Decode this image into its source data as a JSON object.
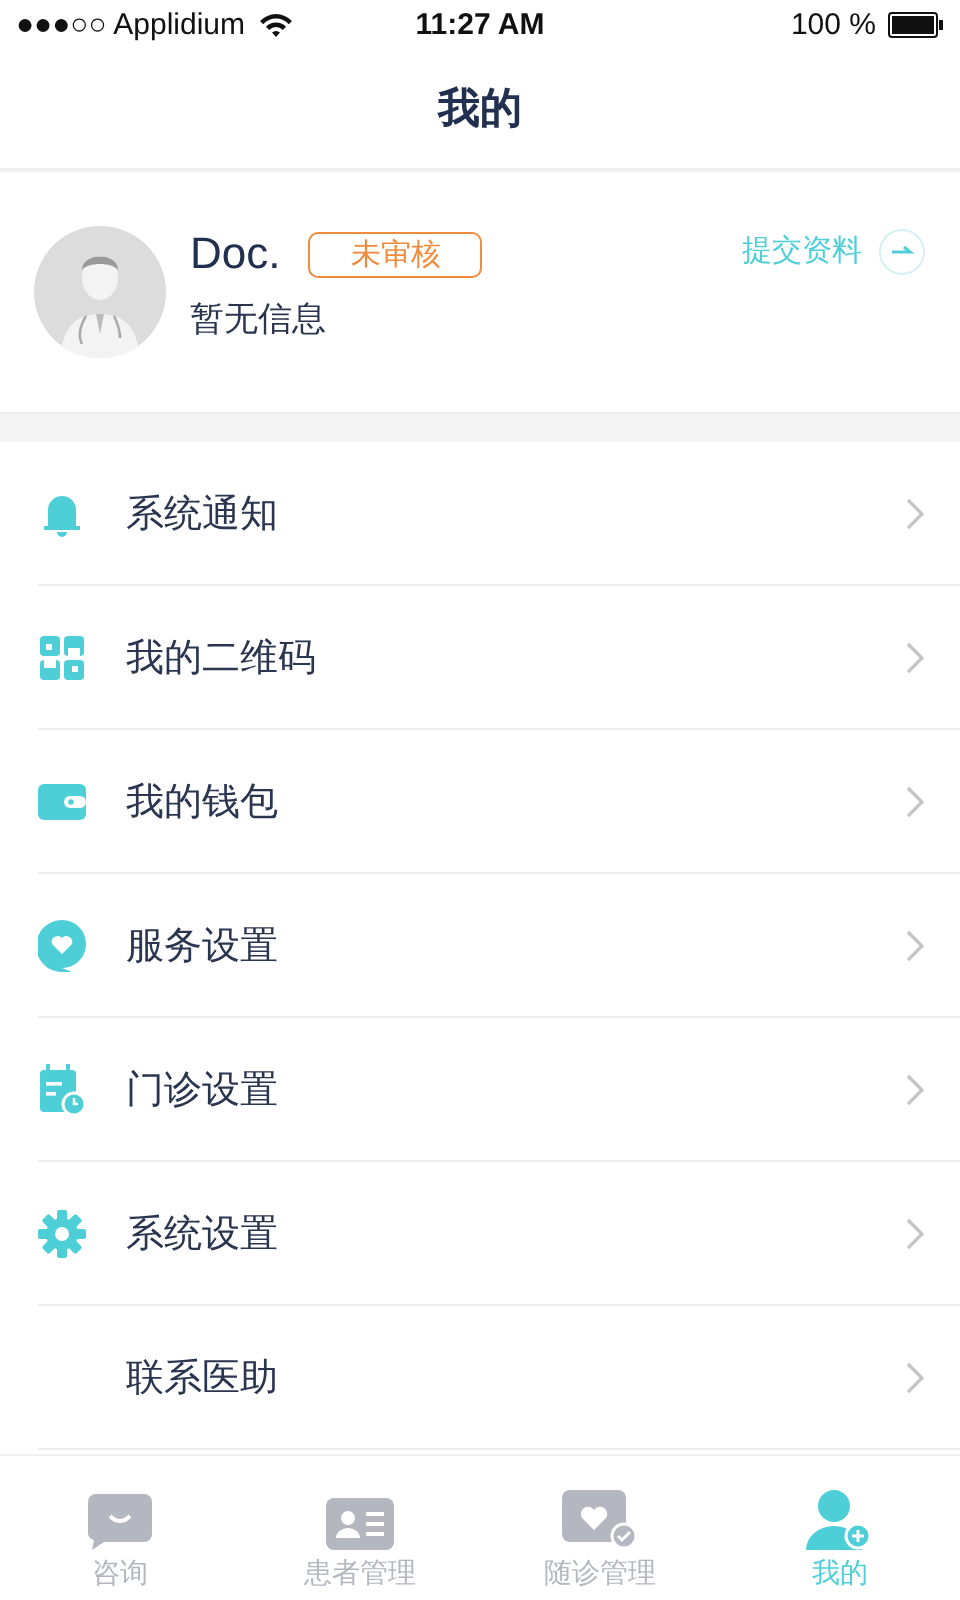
{
  "status_bar": {
    "carrier": "●●●○○ Applidium",
    "time": "11:27 AM",
    "battery": "100 %"
  },
  "nav": {
    "title": "我的"
  },
  "profile": {
    "name": "Doc.",
    "badge": "未审核",
    "subtitle": "暂无信息",
    "action": "提交资料"
  },
  "menu": [
    {
      "label": "系统通知"
    },
    {
      "label": "我的二维码"
    },
    {
      "label": "我的钱包"
    },
    {
      "label": "服务设置"
    },
    {
      "label": "门诊设置"
    },
    {
      "label": "系统设置"
    },
    {
      "label": "联系医助"
    }
  ],
  "tabs": [
    {
      "label": "咨询",
      "selected": false
    },
    {
      "label": "患者管理",
      "selected": false
    },
    {
      "label": "随诊管理",
      "selected": false
    },
    {
      "label": "我的",
      "selected": true
    }
  ]
}
